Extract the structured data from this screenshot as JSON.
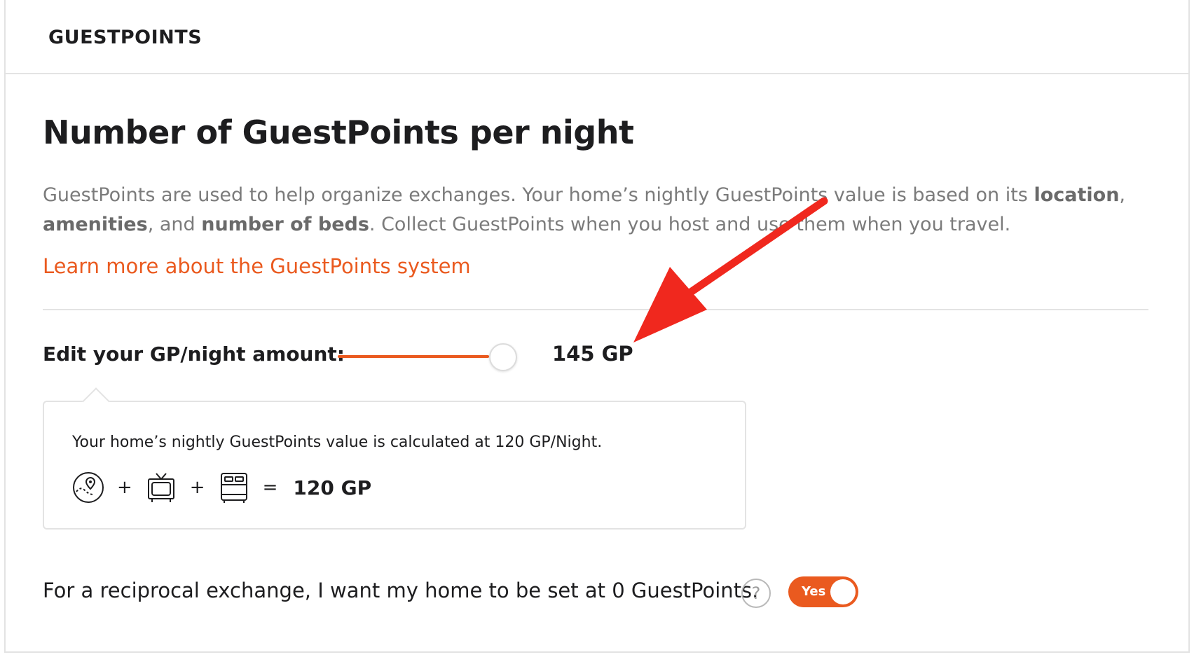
{
  "header": {
    "title": "GUESTPOINTS"
  },
  "main": {
    "heading": "Number of GuestPoints per night",
    "description": {
      "part1": "GuestPoints are used to help organize exchanges. Your home’s nightly GuestPoints value is based on its ",
      "bold1": "location",
      "sep1": ", ",
      "bold2": "amenities",
      "sep2": ", and ",
      "bold3": "number of beds",
      "part2": ". Collect GuestPoints when you host and use them when you travel."
    },
    "learn_more_link": "Learn more about the GuestPoints system",
    "edit": {
      "label": "Edit your GP/night amount:",
      "slider_fraction": 0.81,
      "value_text": "145 GP"
    },
    "calculation": {
      "text": "Your home’s nightly GuestPoints value is calculated at 120 GP/Night.",
      "icons": [
        "location-map-icon",
        "tv-icon",
        "bed-icon"
      ],
      "plus": "+",
      "equals": "=",
      "total": "120 GP"
    },
    "reciprocal": {
      "text": "For a reciprocal exchange, I want my home to be set at 0 GuestPoints.",
      "help_glyph": "?",
      "toggle_label": "Yes",
      "toggle_on": true
    }
  },
  "colors": {
    "accent": "#ea5a1f",
    "annotation_arrow": "#f0281e",
    "text": "#1d1d1f",
    "muted_text": "#7b7b7b",
    "border": "#e3e3e3"
  }
}
